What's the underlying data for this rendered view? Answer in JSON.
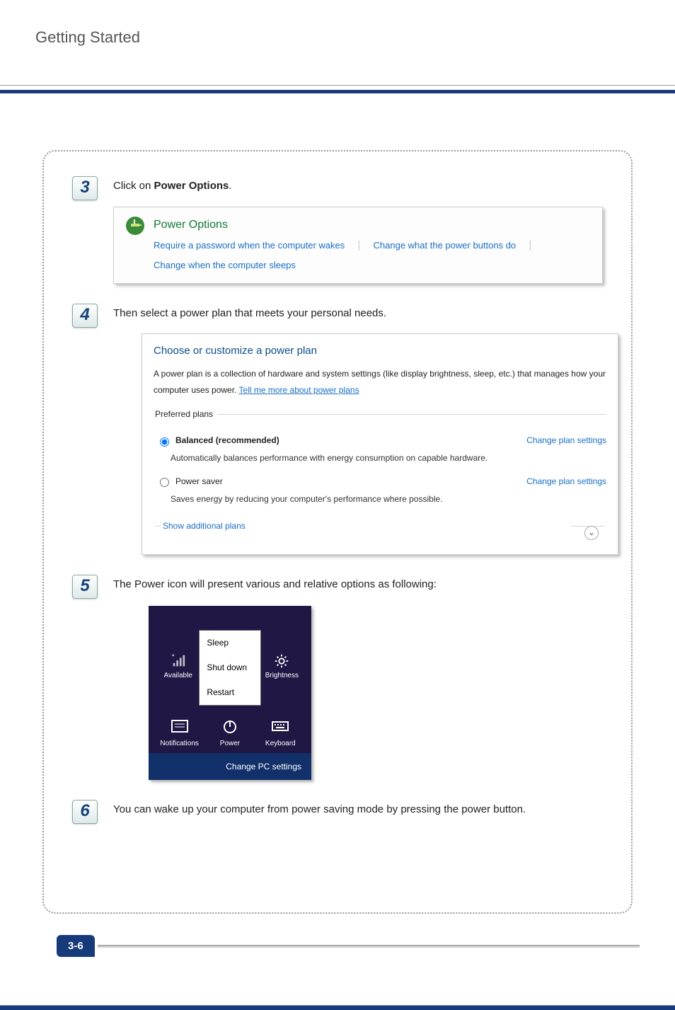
{
  "header": {
    "title": "Getting Started"
  },
  "page_number": "3-6",
  "steps": [
    {
      "num": "3",
      "text_prefix": "Click on ",
      "text_bold": "Power Options",
      "text_suffix": "."
    },
    {
      "num": "4",
      "text": "Then select a power plan that meets your personal needs."
    },
    {
      "num": "5",
      "text": "The Power icon will present various and relative options as following:"
    },
    {
      "num": "6",
      "text": "You can wake up your computer from power saving mode by pressing the power button."
    }
  ],
  "power_options_box": {
    "title": "Power Options",
    "links": [
      "Require a password when the computer wakes",
      "Change what the power buttons do",
      "Change when the computer sleeps"
    ]
  },
  "plan_panel": {
    "title": "Choose or customize a power plan",
    "description_prefix": "A power plan is a collection of hardware and system settings (like display brightness, sleep, etc.) that manages how your computer uses power. ",
    "description_link": "Tell me more about power plans",
    "preferred_label": "Preferred plans",
    "plans": [
      {
        "selected": true,
        "name": "Balanced (recommended)",
        "desc": "Automatically balances performance with energy consumption on capable hardware.",
        "change": "Change plan settings"
      },
      {
        "selected": false,
        "name": "Power saver",
        "desc": "Saves energy by reducing your computer's performance where possible.",
        "change": "Change plan settings"
      }
    ],
    "show_additional": "Show additional plans"
  },
  "charm_panel": {
    "network_label": "Available",
    "brightness_label": "Brightness",
    "menu": [
      "Sleep",
      "Shut down",
      "Restart"
    ],
    "icons": [
      {
        "name": "Notifications"
      },
      {
        "name": "Power"
      },
      {
        "name": "Keyboard"
      }
    ],
    "footer": "Change PC settings"
  }
}
